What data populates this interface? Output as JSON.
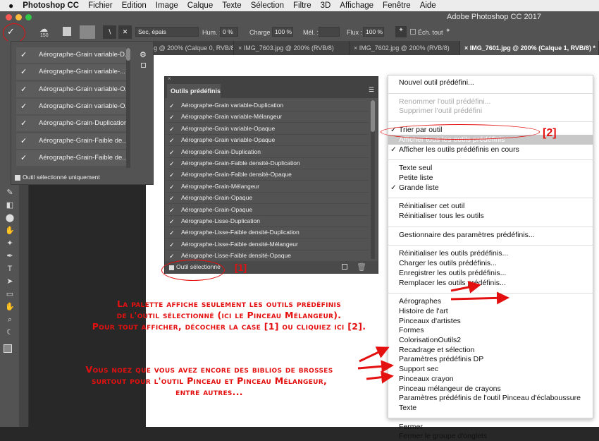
{
  "menubar": {
    "apple": "",
    "app": "Photoshop CC",
    "items": [
      "Fichier",
      "Edition",
      "Image",
      "Calque",
      "Texte",
      "Sélection",
      "Filtre",
      "3D",
      "Affichage",
      "Fenêtre",
      "Aide"
    ]
  },
  "window": {
    "title": "Adobe Photoshop CC 2017"
  },
  "options": {
    "brush_size": "150",
    "brush_preset": "Sec, épais",
    "hum_label": "Hum. :",
    "hum_value": "0 %",
    "charge_label": "Charge :",
    "charge_value": "100 %",
    "mel_label": "Mél. :",
    "mel_value": "",
    "flux_label": "Flux :",
    "flux_value": "100 %",
    "ech_label": "Éch. tout"
  },
  "tabs": [
    "ng @ 200% (Calque 0, RVB/8)",
    "IMG_7603.jpg @ 200% (RVB/8)",
    "IMG_7602.jpg @ 200% (RVB/8)",
    "IMG_7601.jpg @ 200% (Calque 1, RVB/8) *"
  ],
  "dropdown": {
    "items": [
      "Aérographe-Grain variable-D...",
      "Aérographe-Grain variable-...",
      "Aérographe-Grain variable-O...",
      "Aérographe-Grain variable-O...",
      "Aérographe-Grain-Duplication",
      "Aérographe-Grain-Faible de...",
      "Aérographe-Grain-Faible de..."
    ],
    "checkbox_label": "Outil sélectionné uniquement",
    "checkbox_checked": true
  },
  "panel": {
    "title": "Outils prédéfinis",
    "items": [
      "Aérographe-Grain variable-Duplication",
      "Aérographe-Grain variable-Mélangeur",
      "Aérographe-Grain variable-Opaque",
      "Aérographe-Grain variable-Opaque",
      "Aérographe-Grain-Duplication",
      "Aérographe-Grain-Faible densité-Duplication",
      "Aérographe-Grain-Faible densité-Opaque",
      "Aérographe-Grain-Mélangeur",
      "Aérographe-Grain-Opaque",
      "Aérographe-Grain-Opaque",
      "Aérographe-Lisse-Duplication",
      "Aérographe-Lisse-Faible densité-Duplication",
      "Aérographe-Lisse-Faible densité-Mélangeur",
      "Aérographe-Lisse-Faible densité-Opaque"
    ],
    "checkbox_label": "Outil sélectionné",
    "checkbox_checked": true
  },
  "context_menu": {
    "groups": [
      [
        {
          "label": "Nouvel outil prédéfini..."
        }
      ],
      [
        {
          "label": "Renommer l'outil prédéfini...",
          "disabled": true
        },
        {
          "label": "Supprimer l'outil prédéfini",
          "disabled": true
        }
      ],
      [
        {
          "label": "Trier par outil",
          "checked": true
        },
        {
          "label": "Afficher tous les outils prédéfinis",
          "highlighted": true
        },
        {
          "label": "Afficher les outils prédéfinis en cours",
          "checked": true
        }
      ],
      [
        {
          "label": "Texte seul"
        },
        {
          "label": "Petite liste"
        },
        {
          "label": "Grande liste",
          "checked": true
        }
      ],
      [
        {
          "label": "Réinitialiser cet outil"
        },
        {
          "label": "Réinitialiser tous les outils"
        }
      ],
      [
        {
          "label": "Gestionnaire des paramètres prédéfinis..."
        }
      ],
      [
        {
          "label": "Réinitialiser les outils prédéfinis..."
        },
        {
          "label": "Charger les outils prédéfinis..."
        },
        {
          "label": "Enregistrer les outils prédéfinis..."
        },
        {
          "label": "Remplacer les outils prédéfinis..."
        }
      ],
      [
        {
          "label": "Aérographes"
        },
        {
          "label": "Histoire de l'art"
        },
        {
          "label": "Pinceaux d'artistes"
        },
        {
          "label": "Formes"
        },
        {
          "label": "ColorisationOutils2"
        },
        {
          "label": "Recadrage et sélection"
        },
        {
          "label": "Paramètres prédéfinis DP"
        },
        {
          "label": "Support sec"
        },
        {
          "label": "Pinceaux crayon"
        },
        {
          "label": "Pinceau mélangeur de crayons"
        },
        {
          "label": "Paramètres prédéfinis de l'outil Pinceau d'éclaboussure"
        },
        {
          "label": "Texte"
        }
      ],
      [
        {
          "label": "Fermer"
        },
        {
          "label": "Fermer le groupe d'onglets"
        }
      ]
    ]
  },
  "annotations": {
    "label1": "[1]",
    "label2": "[2]",
    "note1": [
      "La palette affiche seulement les outils prédéfinis",
      "de l'outil sélectionné (ici le Pinceau Mélangeur).",
      "Pour tout afficher, décocher la case [1] ou cliquiez ici [2]."
    ],
    "note2": [
      "Vous noez que vous avez encore des biblios de brosses",
      "surtout pour l'outil Pinceau et Pinceau Mélangeur,",
      "entre autres..."
    ],
    "color": "#e41010"
  }
}
